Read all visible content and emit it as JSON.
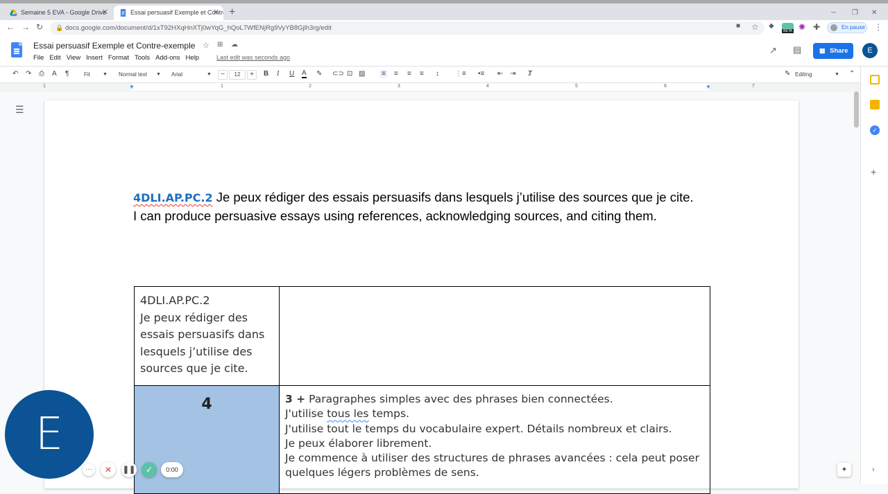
{
  "browser": {
    "tabs": [
      {
        "title": "Semaine 5 EVA - Google Drive",
        "active": false
      },
      {
        "title": "Essai persuasif Exemple et Contré",
        "active": true
      }
    ],
    "url": "docs.google.com/document/d/1xT92HXqHnXTj0wYqG_hQoL7WfENjRg9VyYB8Gjlh3rg/edit",
    "pause_label": "En pause",
    "beta_label": "BETA"
  },
  "docs": {
    "title": "Essai persuasif Exemple et Contre-exemple",
    "menu": [
      "File",
      "Edit",
      "View",
      "Insert",
      "Format",
      "Tools",
      "Add-ons",
      "Help"
    ],
    "last_edit": "Last edit was seconds ago",
    "share_label": "Share",
    "avatar_letter": "E"
  },
  "toolbar": {
    "zoom": "Fit",
    "style": "Normal text",
    "font": "Arial",
    "font_size": "12",
    "mode": "Editing"
  },
  "ruler": {
    "numbers": [
      "1",
      "1",
      "2",
      "3",
      "4",
      "5",
      "6",
      "7"
    ]
  },
  "document": {
    "heading_code": "4DLI.AP.PC.2",
    "heading_fr": " Je peux rédiger des essais persuasifs dans lesquels j’utilise des sources que je cite.",
    "heading_en": "I can produce persuasive essays using references, acknowledging sources, and citing them.",
    "table": {
      "row1_col1_code": "4DLI.AP.PC.2",
      "row1_col1_text": "Je peux rédiger des essais persuasifs dans lesquels j’utilise des sources que je cite.",
      "row1_col2_text": "",
      "row2_level": "4",
      "row2_lead": "3 +",
      "row2_lines": [
        " Paragraphes simples avec des phrases bien connectées.",
        "J'utilise ",
        "tous les",
        " temps.",
        "J'utilise tout le temps du vocabulaire expert. Détails nombreux et clairs.",
        "Je peux élaborer librement.",
        "Je commence à utiliser des structures de phrases avancées : cela peut poser quelques légers problèmes de sens."
      ]
    }
  },
  "recorder": {
    "avatar_letter": "E",
    "timer": "0:00"
  }
}
